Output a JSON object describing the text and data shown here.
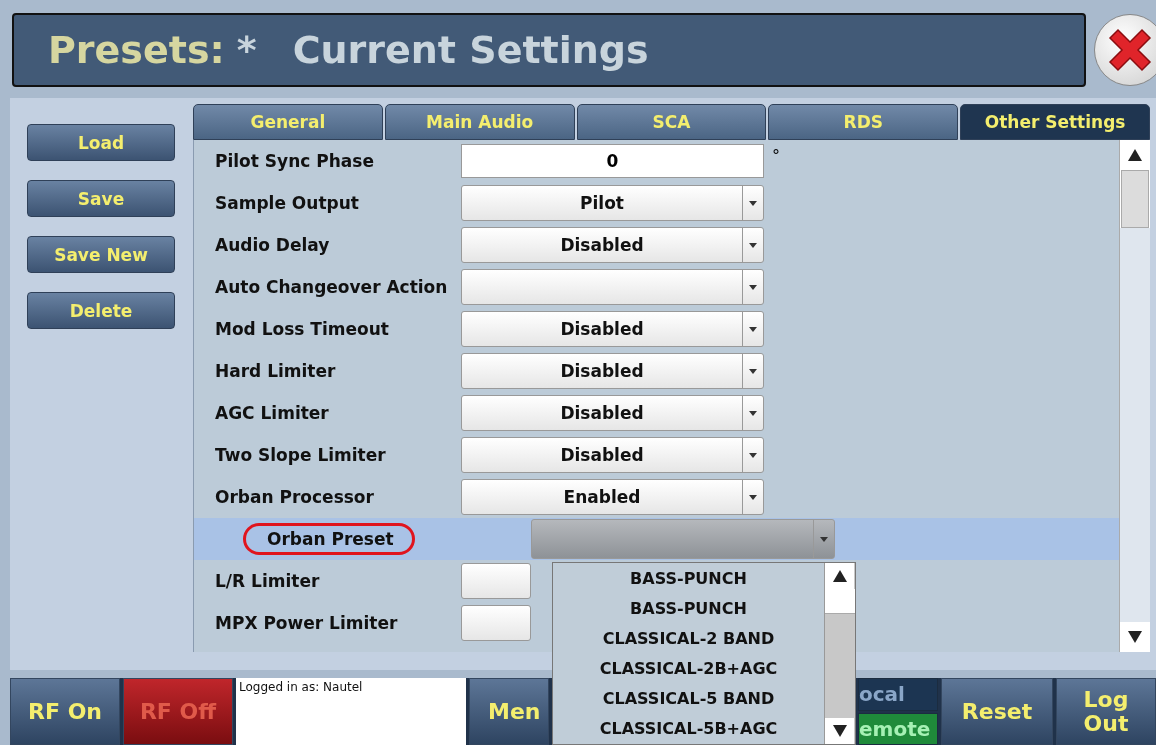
{
  "header": {
    "title": "Presets",
    "separator": ":",
    "modified": "*",
    "preset_name": "Current Settings"
  },
  "side_buttons": [
    "Load",
    "Save",
    "Save New",
    "Delete"
  ],
  "tabs": [
    {
      "label": "General",
      "selected": false
    },
    {
      "label": "Main Audio",
      "selected": false
    },
    {
      "label": "SCA",
      "selected": false
    },
    {
      "label": "RDS",
      "selected": false
    },
    {
      "label": "Other Settings",
      "selected": true
    }
  ],
  "settings": [
    {
      "label": "Pilot Sync Phase",
      "kind": "number",
      "value": "0",
      "unit": "°",
      "highlighted": false,
      "circled": false
    },
    {
      "label": "Sample Output",
      "kind": "dropdown",
      "value": "Pilot",
      "highlighted": false,
      "circled": false
    },
    {
      "label": "Audio Delay",
      "kind": "dropdown",
      "value": "Disabled",
      "highlighted": false,
      "circled": false
    },
    {
      "label": "Auto Changeover Action",
      "kind": "dropdown",
      "highlighted": false,
      "circled": false
    },
    {
      "label": "Mod Loss Timeout",
      "kind": "dropdown",
      "value": "Disabled",
      "highlighted": false,
      "circled": false
    },
    {
      "label": "Hard Limiter",
      "kind": "dropdown",
      "value": "Disabled",
      "highlighted": false,
      "circled": false
    },
    {
      "label": "AGC Limiter",
      "kind": "dropdown",
      "value": "Disabled",
      "highlighted": false,
      "circled": false
    },
    {
      "label": "Two Slope Limiter",
      "kind": "dropdown",
      "value": "Disabled",
      "highlighted": false,
      "circled": false
    },
    {
      "label": "Orban Processor",
      "kind": "dropdown",
      "value": "Enabled",
      "highlighted": false,
      "circled": false
    },
    {
      "label": "Orban Preset",
      "kind": "open-dropdown",
      "highlighted": true,
      "circled": true
    },
    {
      "label": "L/R Limiter",
      "kind": "covered",
      "highlighted": false,
      "circled": false
    },
    {
      "label": "MPX Power Limiter",
      "kind": "covered",
      "highlighted": false,
      "circled": false
    }
  ],
  "dropdown_list": [
    "BASS-PUNCH",
    "BASS-PUNCH",
    "CLASSICAL-2 BAND",
    "CLASSICAL-2B+AGC",
    "CLASSICAL-5 BAND",
    "CLASSICAL-5B+AGC"
  ],
  "bottom_bar": {
    "rf_on": "RF On",
    "rf_off": "RF Off",
    "login": "Logged in as: Nautel",
    "menu": "Men",
    "local": "ocal",
    "remote": "emote",
    "reset": "Reset",
    "logout": "Log Out"
  }
}
